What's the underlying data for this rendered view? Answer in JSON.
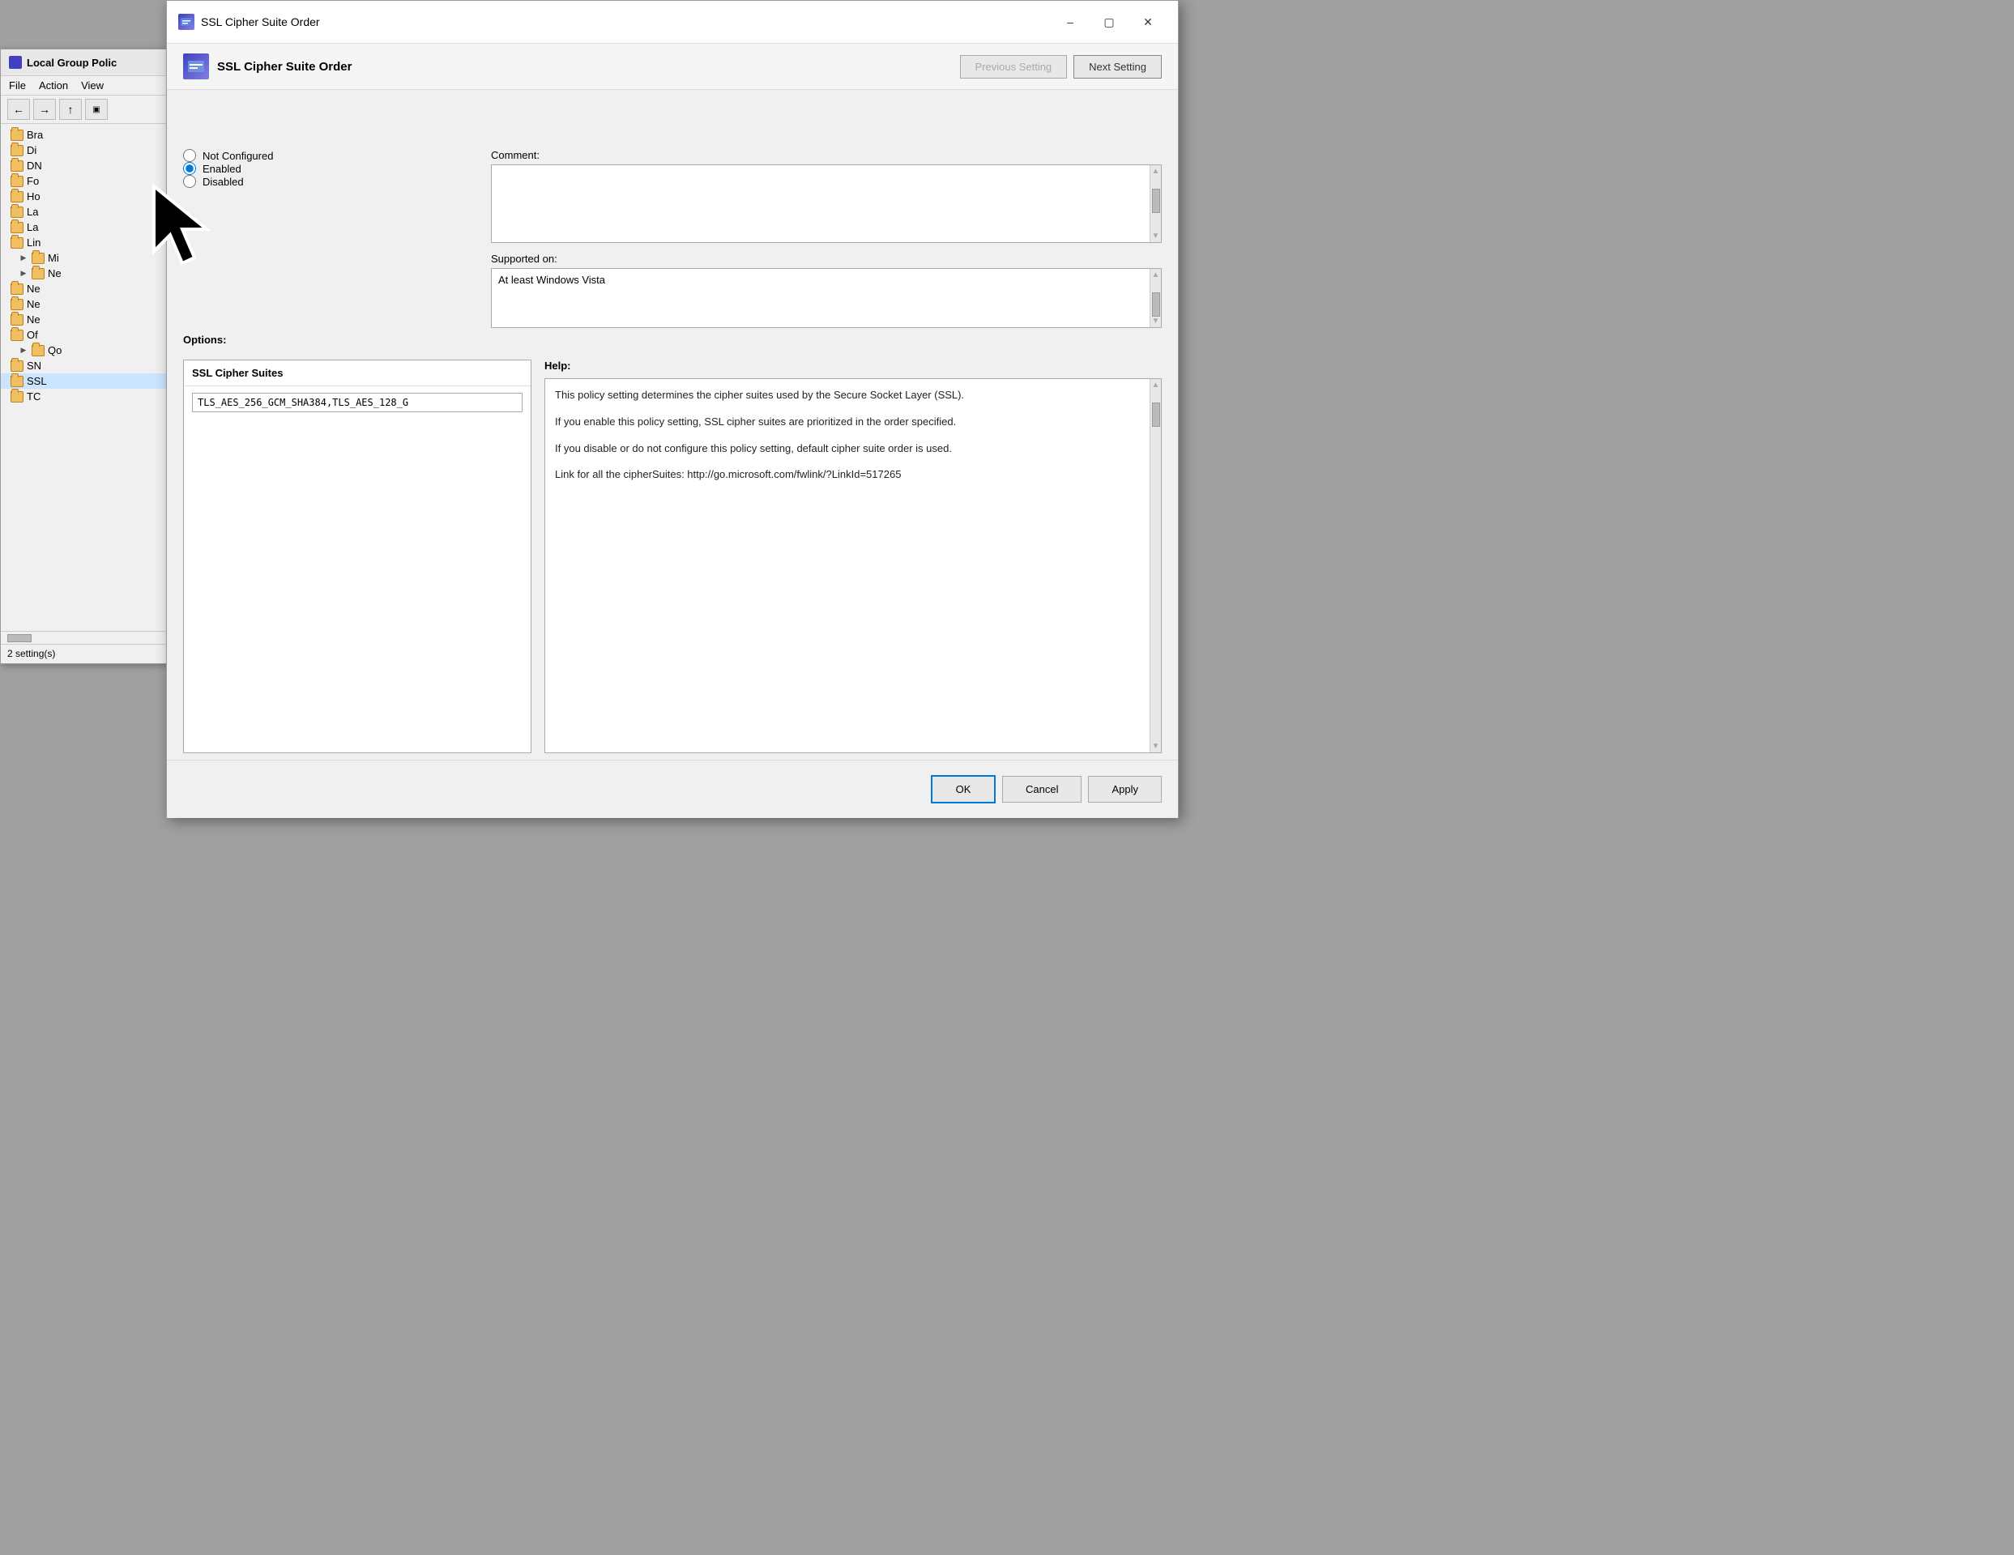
{
  "background_window": {
    "title": "Local Group Polic",
    "menu": [
      "File",
      "Action",
      "View"
    ],
    "tree_items": [
      {
        "label": "Bra",
        "indent": 0,
        "expandable": false
      },
      {
        "label": "Di",
        "indent": 0,
        "expandable": false
      },
      {
        "label": "DN",
        "indent": 0,
        "expandable": false
      },
      {
        "label": "Fo",
        "indent": 0,
        "expandable": false
      },
      {
        "label": "Ho",
        "indent": 0,
        "expandable": false
      },
      {
        "label": "La",
        "indent": 0,
        "expandable": false
      },
      {
        "label": "La",
        "indent": 0,
        "expandable": false
      },
      {
        "label": "Lin",
        "indent": 0,
        "expandable": false
      },
      {
        "label": "Mi",
        "indent": 1,
        "expandable": true
      },
      {
        "label": "Ne",
        "indent": 1,
        "expandable": true
      },
      {
        "label": "Ne",
        "indent": 0,
        "expandable": false
      },
      {
        "label": "Ne",
        "indent": 0,
        "expandable": false
      },
      {
        "label": "Ne",
        "indent": 0,
        "expandable": false
      },
      {
        "label": "Of",
        "indent": 0,
        "expandable": false
      },
      {
        "label": "Qo",
        "indent": 1,
        "expandable": true
      },
      {
        "label": "SN",
        "indent": 0,
        "expandable": false
      },
      {
        "label": "SSL",
        "indent": 0,
        "expandable": false
      },
      {
        "label": "TC",
        "indent": 0,
        "expandable": false
      }
    ],
    "status": "2 setting(s)"
  },
  "dialog": {
    "title": "SSL Cipher Suite Order",
    "header_title": "SSL Cipher Suite Order",
    "prev_btn": "Previous Setting",
    "next_btn": "Next Setting",
    "comment_label": "Comment:",
    "supported_label": "Supported on:",
    "supported_value": "At least Windows Vista",
    "options_label": "Options:",
    "help_label": "Help:",
    "radio_options": [
      {
        "label": "Not Configured",
        "value": "not_configured",
        "checked": false
      },
      {
        "label": "Enabled",
        "value": "enabled",
        "checked": true
      },
      {
        "label": "Disabled",
        "value": "disabled",
        "checked": false
      }
    ],
    "options_section": {
      "title": "SSL Cipher Suites",
      "input_value": "TLS_AES_256_GCM_SHA384,TLS_AES_128_G"
    },
    "help_text": [
      "This policy setting determines the cipher suites used by the Secure Socket Layer (SSL).",
      "If you enable this policy setting, SSL cipher suites are prioritized in the order specified.",
      "If you disable or do not configure this policy setting, default cipher suite order is used.",
      "Link for all the cipherSuites: http://go.microsoft.com/fwlink/?LinkId=517265"
    ],
    "footer": {
      "ok_label": "OK",
      "cancel_label": "Cancel",
      "apply_label": "Apply"
    }
  }
}
